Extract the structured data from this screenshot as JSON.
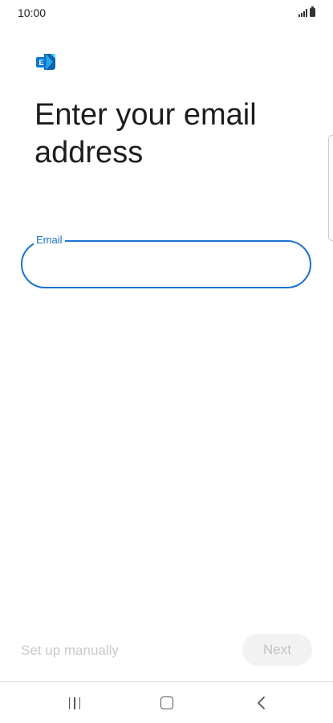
{
  "status_bar": {
    "time": "10:00",
    "icons": [
      "signal-icon",
      "battery-icon"
    ]
  },
  "app": {
    "logo_icon": "exchange-icon",
    "logo_letter": "E",
    "brand_colors": [
      "#0a64ad",
      "#28a8ea",
      "#50d9ff"
    ]
  },
  "screen": {
    "title": "Enter your email address"
  },
  "email_field": {
    "label": "Email",
    "value": "",
    "accent_color": "#1a73d0"
  },
  "actions": {
    "setup_manually_label": "Set up manually",
    "next_label": "Next"
  },
  "nav_bar": {
    "icons": [
      "recent-apps-icon",
      "home-icon",
      "back-icon"
    ]
  }
}
